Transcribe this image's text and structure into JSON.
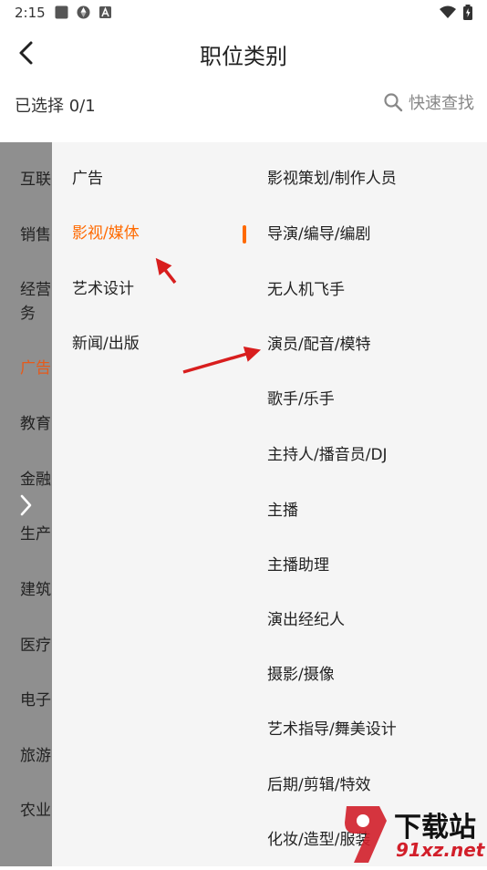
{
  "status_bar": {
    "time": "2:15",
    "left_icons": [
      "square-app-icon",
      "aperture-icon",
      "font-a-icon"
    ],
    "right_icons": [
      "wifi-icon",
      "battery-icon"
    ]
  },
  "header": {
    "title": "职位类别",
    "back_icon": "chevron-left-icon"
  },
  "selection": {
    "count_label": "已选择 0/1",
    "search_label": "快速查找",
    "search_icon": "search-icon"
  },
  "primary_categories": [
    {
      "label": "互联"
    },
    {
      "label": "销售"
    },
    {
      "label": "经营务"
    },
    {
      "label": "广告",
      "active": true
    },
    {
      "label": "教育"
    },
    {
      "label": "金融"
    },
    {
      "label": "生产"
    },
    {
      "label": "建筑"
    },
    {
      "label": "医疗"
    },
    {
      "label": "电子"
    },
    {
      "label": "旅游"
    },
    {
      "label": "农业"
    }
  ],
  "secondary_categories": [
    {
      "label": "广告"
    },
    {
      "label": "影视/媒体",
      "active": true
    },
    {
      "label": "艺术设计"
    },
    {
      "label": "新闻/出版"
    }
  ],
  "tertiary_categories": [
    {
      "label": "影视策划/制作人员"
    },
    {
      "label": "导演/编导/编剧"
    },
    {
      "label": "无人机飞手"
    },
    {
      "label": "演员/配音/模特"
    },
    {
      "label": "歌手/乐手"
    },
    {
      "label": "主持人/播音员/DJ"
    },
    {
      "label": "主播"
    },
    {
      "label": "主播助理"
    },
    {
      "label": "演出经纪人"
    },
    {
      "label": "摄影/摄像"
    },
    {
      "label": "艺术指导/舞美设计"
    },
    {
      "label": "后期/剪辑/特效"
    },
    {
      "label": "化妆/造型/服装"
    }
  ],
  "watermark": {
    "line1": "下载站",
    "line2": "91xz.net"
  },
  "colors": {
    "accent": "#ff6a00",
    "primary_active": "#e65a1a",
    "overlay": "#8f8f8f",
    "panel": "#f5f5f5",
    "annotation_arrow": "#d81e1e"
  }
}
